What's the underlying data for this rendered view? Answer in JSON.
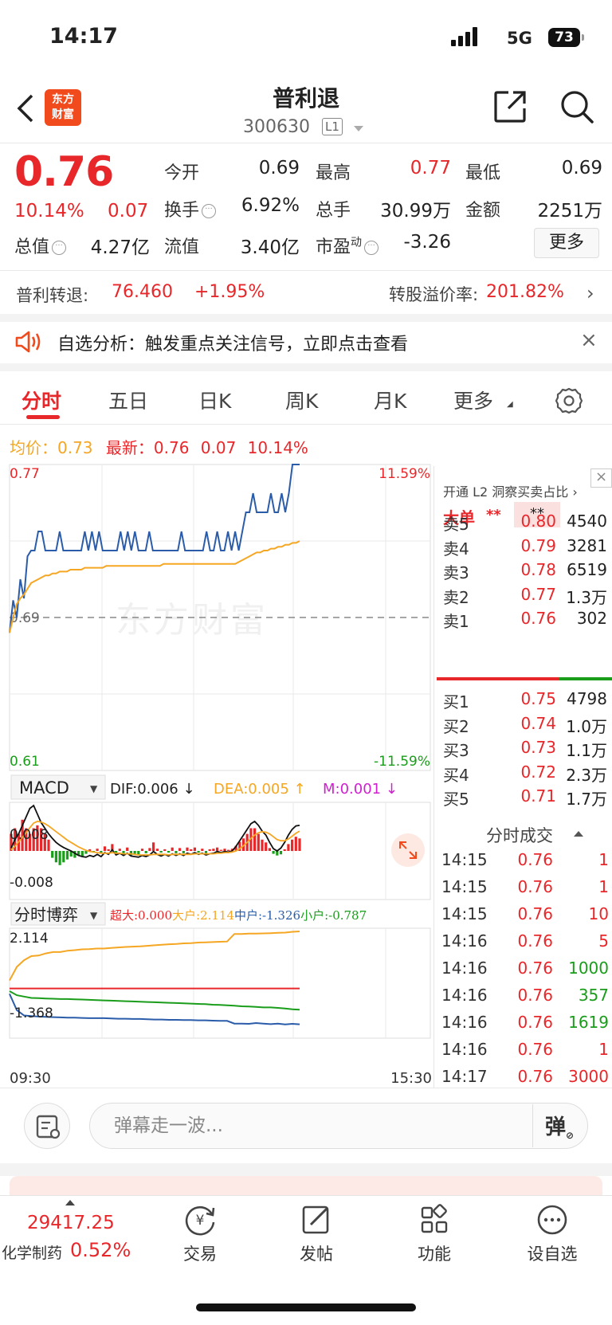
{
  "status": {
    "time": "14:17",
    "network": "5G",
    "battery": "73"
  },
  "header": {
    "logo_line1": "东方",
    "logo_line2": "财富",
    "title": "普利退",
    "code": "300630",
    "level_badge": "L1"
  },
  "quote": {
    "price": "0.76",
    "change_pct": "10.14%",
    "change": "0.07",
    "fields": [
      {
        "label": "今开",
        "value": "0.69",
        "color": "#222222"
      },
      {
        "label": "最高",
        "value": "0.77",
        "color": "#e8272a"
      },
      {
        "label": "最低",
        "value": "0.69",
        "color": "#222222"
      },
      {
        "label": "换手",
        "value": "6.92%",
        "color": "#222222"
      },
      {
        "label": "总手",
        "value": "30.99万",
        "color": "#222222"
      },
      {
        "label": "金额",
        "value": "2251万",
        "color": "#222222"
      },
      {
        "label": "总值",
        "value": "4.27亿",
        "color": "#222222"
      },
      {
        "label": "流值",
        "value": "3.40亿",
        "color": "#222222"
      },
      {
        "label": "市盈",
        "value": "-3.26",
        "color": "#222222"
      }
    ],
    "pe_superscript": "动",
    "more_label": "更多"
  },
  "bond": {
    "name": "普利转退:",
    "price": "76.460",
    "pct": "+1.95%",
    "premium_label": "转股溢价率:",
    "premium_value": "201.82%"
  },
  "notice": {
    "text": "自选分析：触发重点关注信号，立即点击查看"
  },
  "tabs": [
    "分时",
    "五日",
    "日K",
    "周K",
    "月K",
    "更多"
  ],
  "avg": {
    "avg_label": "均价：",
    "avg_value": "0.73",
    "latest_label": "最新：",
    "latest_value": "0.76",
    "latest_change": "0.07",
    "latest_pct": "10.14%"
  },
  "chart_data": [
    {
      "type": "line",
      "title": "分时",
      "ylim": [
        0.61,
        0.77
      ],
      "y_left_labels": [
        "0.77",
        "0.69",
        "0.61"
      ],
      "y_right_labels": [
        "11.59%",
        "-11.59%"
      ],
      "prev_close": "0.69",
      "x_labels": [
        "09:30",
        "15:30"
      ],
      "watermark": "东方财富",
      "series": [
        {
          "color": "#2a5caa",
          "values": [
            0.682,
            0.699,
            0.69,
            0.71,
            0.7,
            0.722,
            0.725,
            0.725,
            0.735,
            0.735,
            0.725,
            0.725,
            0.725,
            0.725,
            0.735,
            0.725,
            0.725,
            0.725,
            0.725,
            0.725,
            0.725,
            0.735,
            0.725,
            0.735,
            0.725,
            0.735,
            0.725,
            0.725,
            0.725,
            0.725,
            0.725,
            0.735,
            0.725,
            0.735,
            0.725,
            0.735,
            0.725,
            0.725,
            0.725,
            0.735,
            0.725,
            0.725,
            0.725,
            0.725,
            0.725,
            0.725,
            0.725,
            0.725,
            0.735,
            0.725,
            0.725,
            0.725,
            0.725,
            0.725,
            0.725,
            0.735,
            0.725,
            0.725,
            0.735,
            0.725,
            0.725,
            0.735,
            0.725,
            0.735,
            0.725,
            0.735,
            0.745,
            0.745,
            0.755,
            0.745,
            0.745,
            0.745,
            0.745,
            0.755,
            0.745,
            0.745,
            0.755,
            0.745,
            0.755,
            0.77,
            0.77,
            0.77
          ]
        },
        {
          "color": "#f5a623",
          "values": [
            0.682,
            0.69,
            0.697,
            0.7,
            0.702,
            0.705,
            0.708,
            0.709,
            0.71,
            0.711,
            0.712,
            0.712,
            0.713,
            0.713,
            0.714,
            0.714,
            0.714,
            0.715,
            0.715,
            0.715,
            0.715,
            0.716,
            0.716,
            0.716,
            0.716,
            0.716,
            0.716,
            0.717,
            0.717,
            0.717,
            0.717,
            0.717,
            0.717,
            0.717,
            0.717,
            0.717,
            0.717,
            0.717,
            0.717,
            0.717,
            0.717,
            0.717,
            0.717,
            0.718,
            0.718,
            0.718,
            0.718,
            0.718,
            0.718,
            0.718,
            0.718,
            0.718,
            0.718,
            0.718,
            0.718,
            0.718,
            0.718,
            0.718,
            0.718,
            0.718,
            0.718,
            0.718,
            0.718,
            0.718,
            0.719,
            0.72,
            0.721,
            0.722,
            0.723,
            0.724,
            0.724,
            0.725,
            0.725,
            0.726,
            0.726,
            0.727,
            0.727,
            0.728,
            0.728,
            0.729,
            0.729,
            0.73
          ]
        }
      ]
    },
    {
      "type": "bar",
      "title": "MACD",
      "dif": "DIF:0.006 ↓",
      "dea": "DEA:0.005 ↑",
      "m": "M:0.001 ↓",
      "y_labels": [
        "0.008",
        "-0.008"
      ],
      "ylim": [
        -0.008,
        0.008
      ],
      "histogram": [
        0.003,
        0.004,
        0.003,
        0.0055,
        0.004,
        0.003,
        0.004,
        0.0045,
        0.004,
        0.003,
        0.002,
        -0.0012,
        -0.002,
        -0.0025,
        -0.002,
        -0.0015,
        -0.001,
        -0.0012,
        -0.0008,
        -0.001,
        -0.0005,
        0.0003,
        -0.0003,
        0.0004,
        -0.0004,
        0.0008,
        0.0003,
        0.0012,
        -0.0003,
        0.0004,
        -0.0006,
        0.0006,
        -0.0008,
        -0.0005,
        -0.0008,
        0.0004,
        -0.0004,
        0.0005,
        0.0015,
        0.0004,
        -0.0003,
        0.0003,
        -0.0003,
        0.0006,
        -0.0004,
        0.0005,
        -0.0004,
        0.0006,
        0.0003,
        0.0006,
        -0.0003,
        0.0004,
        -0.0004,
        0.0003,
        0.0004,
        0.0006,
        0.0002,
        0.0004,
        0.0002,
        0.0004,
        0.0009,
        0.0016,
        0.0022,
        0.003,
        0.004,
        0.004,
        0.003,
        0.002,
        0.0015,
        0.0005,
        -0.0005,
        -0.0008,
        -0.0006,
        0.0003,
        0.0012,
        0.002,
        0.0025,
        0.0022
      ],
      "series": [
        {
          "color": "#111111",
          "values": [
            0.0005,
            0.002,
            0.003,
            0.0045,
            0.006,
            0.0075,
            0.008,
            0.0065,
            0.005,
            0.004,
            0.003,
            0.0022,
            0.0015,
            0.001,
            0.0006,
            0.0003,
            0.0,
            -0.0004,
            -0.0008,
            -0.001,
            -0.0011,
            -0.0008,
            -0.001,
            -0.0006,
            -0.001,
            -0.0003,
            -0.0006,
            0.0002,
            -0.0007,
            -0.0004,
            -0.0008,
            -0.0004,
            -0.0009,
            -0.001,
            -0.0011,
            -0.0008,
            -0.001,
            -0.0007,
            -0.0001,
            -0.0006,
            -0.0009,
            -0.0006,
            -0.0009,
            -0.0005,
            -0.0008,
            -0.0005,
            -0.0008,
            -0.0004,
            -0.0006,
            -0.0003,
            -0.0006,
            -0.0004,
            -0.0007,
            -0.0005,
            -0.0004,
            -0.0001,
            -0.0003,
            -0.0001,
            -0.0002,
            0.0,
            0.0008,
            0.0018,
            0.0028,
            0.0038,
            0.0048,
            0.0052,
            0.0045,
            0.0035,
            0.0028,
            0.0015,
            0.0004,
            0.0,
            0.0005,
            0.0015,
            0.0028,
            0.0038,
            0.0044,
            0.0045
          ]
        },
        {
          "color": "#f5a623",
          "values": [
            0.0002,
            0.0008,
            0.0016,
            0.0024,
            0.0032,
            0.0041,
            0.0049,
            0.0052,
            0.0051,
            0.0048,
            0.0044,
            0.0039,
            0.0034,
            0.0029,
            0.0024,
            0.0019,
            0.0015,
            0.0011,
            0.0007,
            0.0004,
            0.0001,
            -0.0001,
            -0.0002,
            -0.0003,
            -0.0004,
            -0.0004,
            -0.0004,
            -0.0003,
            -0.0004,
            -0.0004,
            -0.0005,
            -0.0005,
            -0.0005,
            -0.0006,
            -0.0007,
            -0.0007,
            -0.0007,
            -0.0007,
            -0.0006,
            -0.0006,
            -0.0006,
            -0.0006,
            -0.0007,
            -0.0006,
            -0.0006,
            -0.0006,
            -0.0006,
            -0.0006,
            -0.0006,
            -0.0005,
            -0.0005,
            -0.0005,
            -0.0005,
            -0.0005,
            -0.0005,
            -0.0004,
            -0.0004,
            -0.0003,
            -0.0003,
            -0.0002,
            0.0,
            0.0004,
            0.0009,
            0.0015,
            0.0022,
            0.0028,
            0.0032,
            0.0034,
            0.0033,
            0.003,
            0.0025,
            0.002,
            0.0018,
            0.0018,
            0.0021,
            0.0026,
            0.0031,
            0.0035
          ]
        }
      ]
    },
    {
      "type": "line",
      "title": "分时博弈",
      "y_labels": [
        "2.114",
        "-1.368"
      ],
      "ylim": [
        -1.368,
        2.114
      ],
      "legend": [
        {
          "name": "超大:0.000",
          "color": "#e8272a"
        },
        {
          "name": "大户:2.114",
          "color": "#f5a623"
        },
        {
          "name": "中户:-1.326",
          "color": "#2a5caa"
        },
        {
          "name": "小户:-0.787",
          "color": "#1a9d1a"
        }
      ],
      "series": [
        {
          "color": "#e8272a",
          "values": [
            0.0,
            0.0,
            0.0,
            0.0,
            0.0,
            0.0,
            0.0,
            0.0,
            0.0,
            0.0,
            0.0,
            0.0,
            0.0,
            0.0,
            0.0,
            0.0,
            0.0,
            0.0,
            0.0,
            0.0,
            0.0,
            0.0,
            0.0,
            0.0,
            0.0,
            0.0,
            0.0,
            0.0,
            0.0,
            0.0,
            0.0,
            0.0,
            0.0,
            0.0,
            0.0,
            0.0,
            0.0,
            0.0,
            0.0,
            0.0,
            0.0
          ]
        },
        {
          "color": "#f5a623",
          "values": [
            0.3,
            0.8,
            1.05,
            1.2,
            1.22,
            1.3,
            1.35,
            1.35,
            1.4,
            1.42,
            1.45,
            1.46,
            1.48,
            1.48,
            1.5,
            1.52,
            1.54,
            1.55,
            1.56,
            1.58,
            1.6,
            1.62,
            1.64,
            1.65,
            1.67,
            1.68,
            1.7,
            1.71,
            1.72,
            1.73,
            1.74,
            2.02,
            2.02,
            2.03,
            2.03,
            2.04,
            2.05,
            2.06,
            2.07,
            2.1,
            2.114
          ]
        },
        {
          "color": "#1a9d1a",
          "values": [
            -0.1,
            -0.25,
            -0.3,
            -0.35,
            -0.36,
            -0.37,
            -0.38,
            -0.39,
            -0.39,
            -0.4,
            -0.41,
            -0.42,
            -0.43,
            -0.44,
            -0.45,
            -0.46,
            -0.47,
            -0.48,
            -0.49,
            -0.5,
            -0.51,
            -0.52,
            -0.53,
            -0.54,
            -0.55,
            -0.56,
            -0.57,
            -0.58,
            -0.6,
            -0.61,
            -0.62,
            -0.64,
            -0.66,
            -0.67,
            -0.68,
            -0.7,
            -0.7,
            -0.72,
            -0.74,
            -0.77,
            -0.787
          ]
        },
        {
          "color": "#2a5caa",
          "values": [
            -0.2,
            -0.8,
            -1.0,
            -1.02,
            -1.04,
            -1.05,
            -1.06,
            -1.07,
            -1.08,
            -1.08,
            -1.09,
            -1.1,
            -1.1,
            -1.1,
            -1.11,
            -1.12,
            -1.12,
            -1.13,
            -1.13,
            -1.14,
            -1.15,
            -1.15,
            -1.16,
            -1.16,
            -1.17,
            -1.17,
            -1.18,
            -1.18,
            -1.19,
            -1.2,
            -1.2,
            -1.3,
            -1.3,
            -1.31,
            -1.28,
            -1.3,
            -1.32,
            -1.3,
            -1.33,
            -1.31,
            -1.326
          ]
        }
      ]
    }
  ],
  "macd_selector": "MACD",
  "game_selector": "分时博弈",
  "panel": {
    "l2_text": "开通 L2 洞察买卖占比",
    "big_label": "大单",
    "big_stars1": "**",
    "big_stars2": "**",
    "asks": [
      {
        "label": "卖5",
        "price": "0.80",
        "vol": "4540"
      },
      {
        "label": "卖4",
        "price": "0.79",
        "vol": "3281"
      },
      {
        "label": "卖3",
        "price": "0.78",
        "vol": "6519"
      },
      {
        "label": "卖2",
        "price": "0.77",
        "vol": "1.3万"
      },
      {
        "label": "卖1",
        "price": "0.76",
        "vol": "302"
      }
    ],
    "bids": [
      {
        "label": "买1",
        "price": "0.75",
        "vol": "4798"
      },
      {
        "label": "买2",
        "price": "0.74",
        "vol": "1.0万"
      },
      {
        "label": "买3",
        "price": "0.73",
        "vol": "1.1万"
      },
      {
        "label": "买4",
        "price": "0.72",
        "vol": "2.3万"
      },
      {
        "label": "买5",
        "price": "0.71",
        "vol": "1.7万"
      }
    ],
    "trades_title": "分时成交",
    "trades": [
      {
        "time": "14:15",
        "price": "0.76",
        "vol": "1",
        "color": "#e8272a"
      },
      {
        "time": "14:15",
        "price": "0.76",
        "vol": "1",
        "color": "#e8272a"
      },
      {
        "time": "14:15",
        "price": "0.76",
        "vol": "10",
        "color": "#e8272a"
      },
      {
        "time": "14:16",
        "price": "0.76",
        "vol": "5",
        "color": "#e8272a"
      },
      {
        "time": "14:16",
        "price": "0.76",
        "vol": "1000",
        "color": "#1a9d1a"
      },
      {
        "time": "14:16",
        "price": "0.76",
        "vol": "357",
        "color": "#1a9d1a"
      },
      {
        "time": "14:16",
        "price": "0.76",
        "vol": "1619",
        "color": "#1a9d1a"
      },
      {
        "time": "14:16",
        "price": "0.76",
        "vol": "1",
        "color": "#e8272a"
      },
      {
        "time": "14:17",
        "price": "0.76",
        "vol": "3000",
        "color": "#e8272a"
      }
    ]
  },
  "danmaku": {
    "placeholder": "弹幕走一波...",
    "button": "弹"
  },
  "bottom": {
    "index_value": "29417.25",
    "index_name": "化学制药",
    "index_pct": "0.52%",
    "nav": [
      {
        "label": "交易",
        "icon": "yen-refresh-icon"
      },
      {
        "label": "发帖",
        "icon": "edit-icon"
      },
      {
        "label": "功能",
        "icon": "grid-icon"
      },
      {
        "label": "设自选",
        "icon": "more-dots-icon"
      }
    ]
  }
}
